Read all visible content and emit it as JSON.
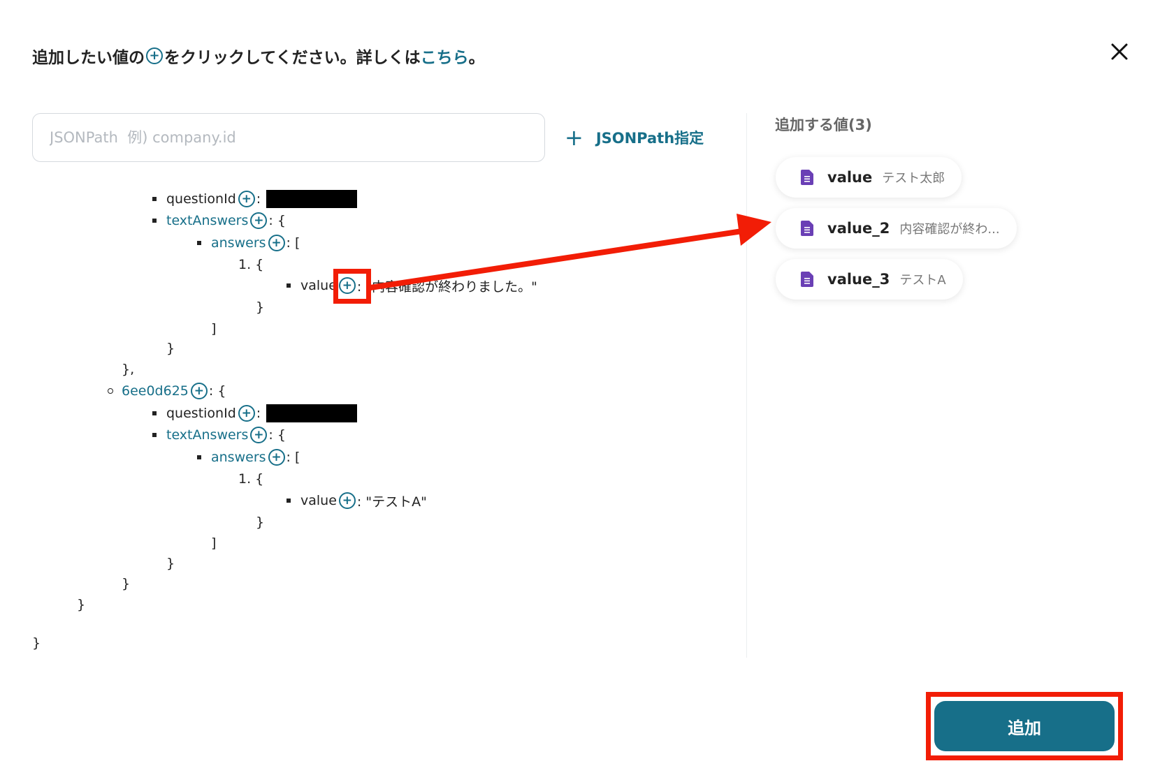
{
  "header": {
    "text_before": "追加したい値の",
    "plus_glyph": "+",
    "text_after": "をクリックしてください。詳しくは",
    "link": "こちら",
    "period": "。"
  },
  "search": {
    "placeholder": "JSONPath  例) company.id",
    "value": ""
  },
  "jsonpath_button": {
    "plus": "+",
    "label": "JSONPath指定"
  },
  "tree": {
    "q1_key": "questionId",
    "textAnswers_key": "textAnswers",
    "answers_key": "answers",
    "value_key": "value",
    "colon": ":",
    "colon_brace": ": {",
    "colon_bracket": ": [",
    "item_open": "1. {",
    "close_brace": "}",
    "close_bracket": "]",
    "close_brace_comma": "},",
    "value_1": ": \"内容確認が終わりました。\"",
    "node2_key": "6ee0d625",
    "value_2": ": \"テストA\""
  },
  "selected": {
    "title": "追加する値(3)",
    "items": [
      {
        "name": "value",
        "value": "テスト太郎"
      },
      {
        "name": "value_2",
        "value": "内容確認が終わ..."
      },
      {
        "name": "value_3",
        "value": "テストA"
      }
    ]
  },
  "add_button": {
    "label": "追加"
  },
  "colors": {
    "accent": "#176f89",
    "annotation": "#f21d06",
    "doc_icon": "#6a3fb5"
  }
}
